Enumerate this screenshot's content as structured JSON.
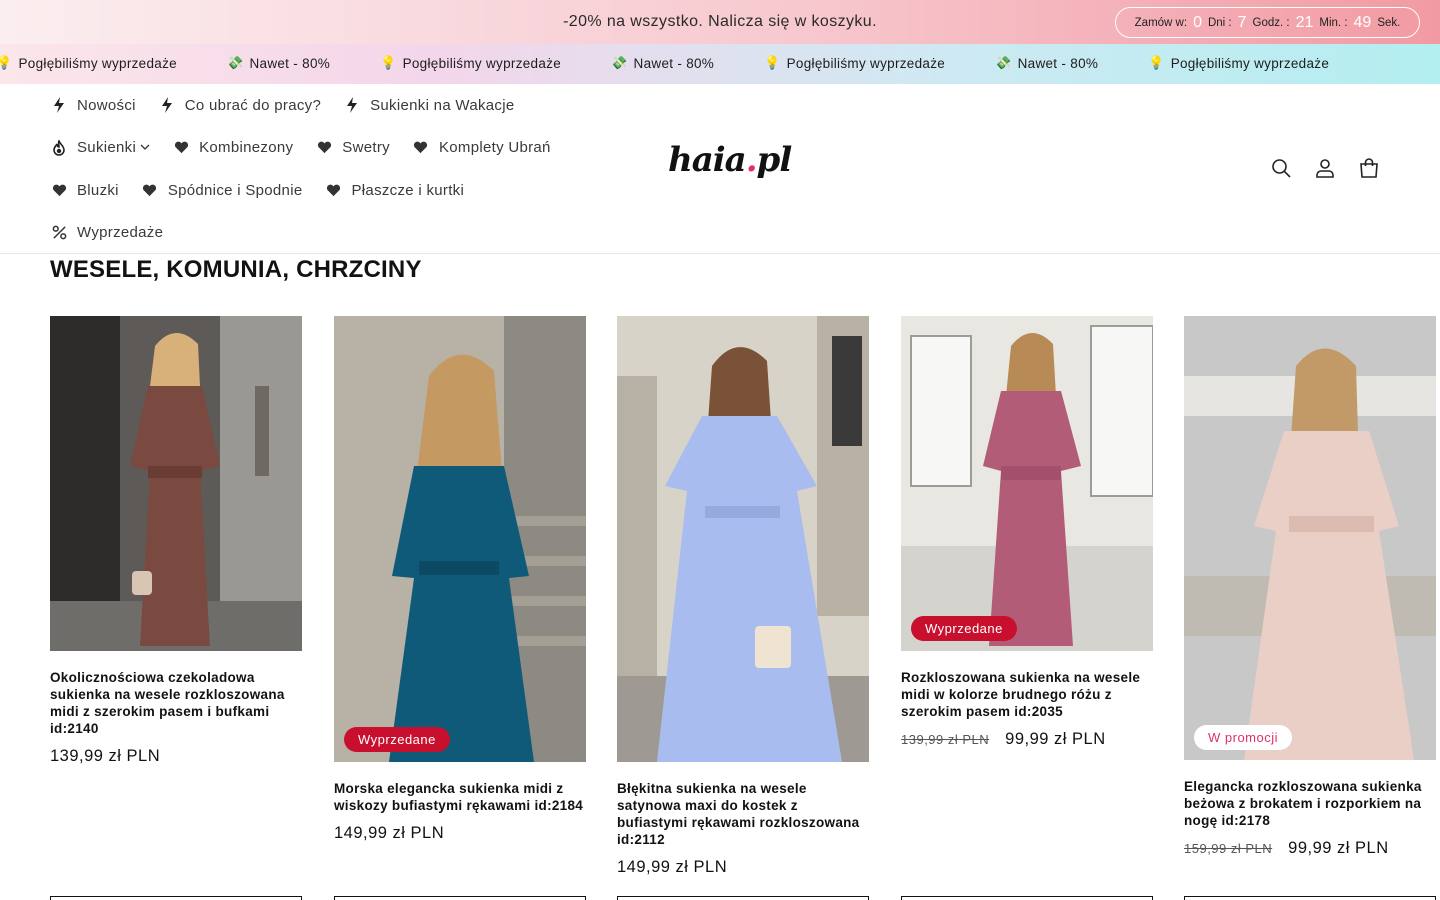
{
  "announcement": {
    "text": "-20% na wszystko. Nalicza się w koszyku.",
    "countdown": {
      "prefix": "Zamów w:",
      "days": "0",
      "days_label": "Dni :",
      "hours": "7",
      "hours_label": "Godz. :",
      "minutes": "21",
      "minutes_label": "Min. :",
      "seconds": "49",
      "seconds_label": "Sek."
    }
  },
  "marquee": {
    "items": [
      {
        "icon": "💡",
        "text": "Pogłębiliśmy wyprzedaże"
      },
      {
        "icon": "💸",
        "text": "Nawet - 80%"
      },
      {
        "icon": "💡",
        "text": "Pogłębiliśmy wyprzedaże"
      },
      {
        "icon": "💸",
        "text": "Nawet - 80%"
      },
      {
        "icon": "💡",
        "text": "Pogłębiliśmy wyprzedaże"
      },
      {
        "icon": "💸",
        "text": "Nawet - 80%"
      },
      {
        "icon": "💡",
        "text": "Pogłębiliśmy wyprzedaże"
      }
    ]
  },
  "nav": {
    "items": [
      {
        "label": "Nowości",
        "icon": "lightning-icon"
      },
      {
        "label": "Co ubrać do pracy?",
        "icon": "lightning-icon"
      },
      {
        "label": "Sukienki na Wakacje",
        "icon": "lightning-icon"
      },
      {
        "label": "Sukienki",
        "icon": "fire-icon",
        "has_dropdown": true
      },
      {
        "label": "Kombinezony",
        "icon": "heart-icon"
      },
      {
        "label": "Swetry",
        "icon": "heart-icon"
      },
      {
        "label": "Komplety Ubrań",
        "icon": "heart-icon"
      },
      {
        "label": "Bluzki",
        "icon": "heart-icon"
      },
      {
        "label": "Spódnice i Spodnie",
        "icon": "heart-icon"
      },
      {
        "label": "Płaszcze i kurtki",
        "icon": "heart-icon"
      },
      {
        "label": "Wyprzedaże",
        "icon": "percent-icon"
      }
    ]
  },
  "logo": {
    "text": "haia",
    "dot": ".",
    "suffix": "pl"
  },
  "header_icons": [
    "search-icon",
    "account-icon",
    "cart-icon"
  ],
  "section": {
    "title": "WESELE, KOMUNIA, CHRZCINY"
  },
  "products": [
    {
      "title": "Okolicznościowa czekoladowa sukienka na wesele rozkloszowana midi z szerokim pasem i bufkami id:2140",
      "price": "139,99 zł PLN",
      "badge": "",
      "dress_color": "#7a4a40",
      "bg_color": "#5e5a57"
    },
    {
      "title": "Morska elegancka sukienka midi z wiskozy bufiastymi rękawami id:2184",
      "price": "149,99 zł PLN",
      "badge": "Wyprzedane",
      "dress_color": "#0f5a78",
      "bg_color": "#b8b2a6"
    },
    {
      "title": "Błękitna sukienka na wesele satynowa maxi do kostek z bufiastymi rękawami rozkloszowana id:2112",
      "price": "149,99 zł PLN",
      "badge": "",
      "dress_color": "#a9bcef",
      "bg_color": "#d8d3c8"
    },
    {
      "title": "Rozkloszowana sukienka na wesele midi w kolorze brudnego różu z szerokim pasem id:2035",
      "old_price": "139,99 zł PLN",
      "price": "99,99 zł PLN",
      "badge": "Wyprzedane",
      "dress_color": "#b35c78",
      "bg_color": "#e9e7e2"
    },
    {
      "title": "Elegancka rozkloszowana sukienka beżowa z brokatem i rozporkiem na nogę id:2178",
      "old_price": "159,99 zł PLN",
      "price": "99,99 zł PLN",
      "badge": "W promocji",
      "dress_color": "#e9cfc6",
      "bg_color": "#c9c8c8"
    }
  ],
  "colors": {
    "accent_pink": "#e0306d",
    "sold_red": "#c8102e"
  }
}
